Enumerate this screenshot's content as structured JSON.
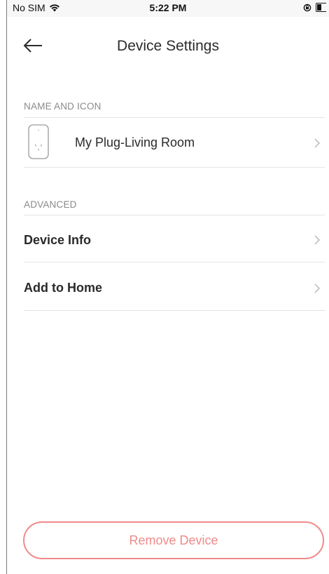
{
  "status_bar": {
    "carrier": "No SIM",
    "time": "5:22 PM"
  },
  "header": {
    "title": "Device Settings",
    "back_icon": "arrow-left-icon"
  },
  "sections": {
    "name_and_icon": {
      "header": "NAME AND ICON",
      "device_name": "My Plug-Living Room",
      "device_icon": "smart-plug-icon"
    },
    "advanced": {
      "header": "ADVANCED",
      "items": [
        {
          "label": "Device Info"
        },
        {
          "label": "Add to Home"
        }
      ]
    }
  },
  "footer": {
    "remove_label": "Remove Device"
  },
  "colors": {
    "danger": "#f08a8a",
    "divider": "#e4e4e4",
    "section_header": "#8a8a8a"
  }
}
